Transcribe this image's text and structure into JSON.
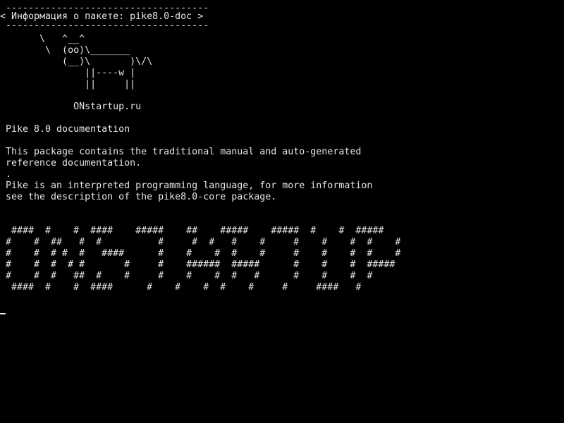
{
  "terminal": {
    "background": "#000000",
    "foreground": "#e6e6e6",
    "bubble": {
      "top_border": " ------------------------------------",
      "text": "< Информация о пакете: pike8.0-doc >",
      "bottom_border": " ------------------------------------"
    },
    "cow": [
      "       \\   ^__^",
      "        \\  (oo)\\_______",
      "           (__)\\       )\\/\\",
      "               ||----w |",
      "               ||     ||"
    ],
    "site": "             ONstartup.ru",
    "title": "Pike 8.0 documentation",
    "description": [
      "This package contains the traditional manual and auto-generated",
      "reference documentation.",
      ".",
      "Pike is an interpreted programming language, for more information",
      "see the description of the pike8.0-core package."
    ],
    "banner": [
      " ####  #    #  ####    #####    ##    #####    #####  #    #  #####",
      "#    #  ##   #  #          #     #  #   #    #     #    #    #  #    #",
      "#    #  # #  #   ####      #    #    #  #    #     #    #    #  #    #",
      "#    #  #  # #       #     #    ######  #####      #    #    #  #####",
      "#    #  #   ##  #    #     #    #    #  #   #      #    #    #  #",
      " ####  #    #  ####      #    #    #  #    #     #     ####   #"
    ]
  }
}
